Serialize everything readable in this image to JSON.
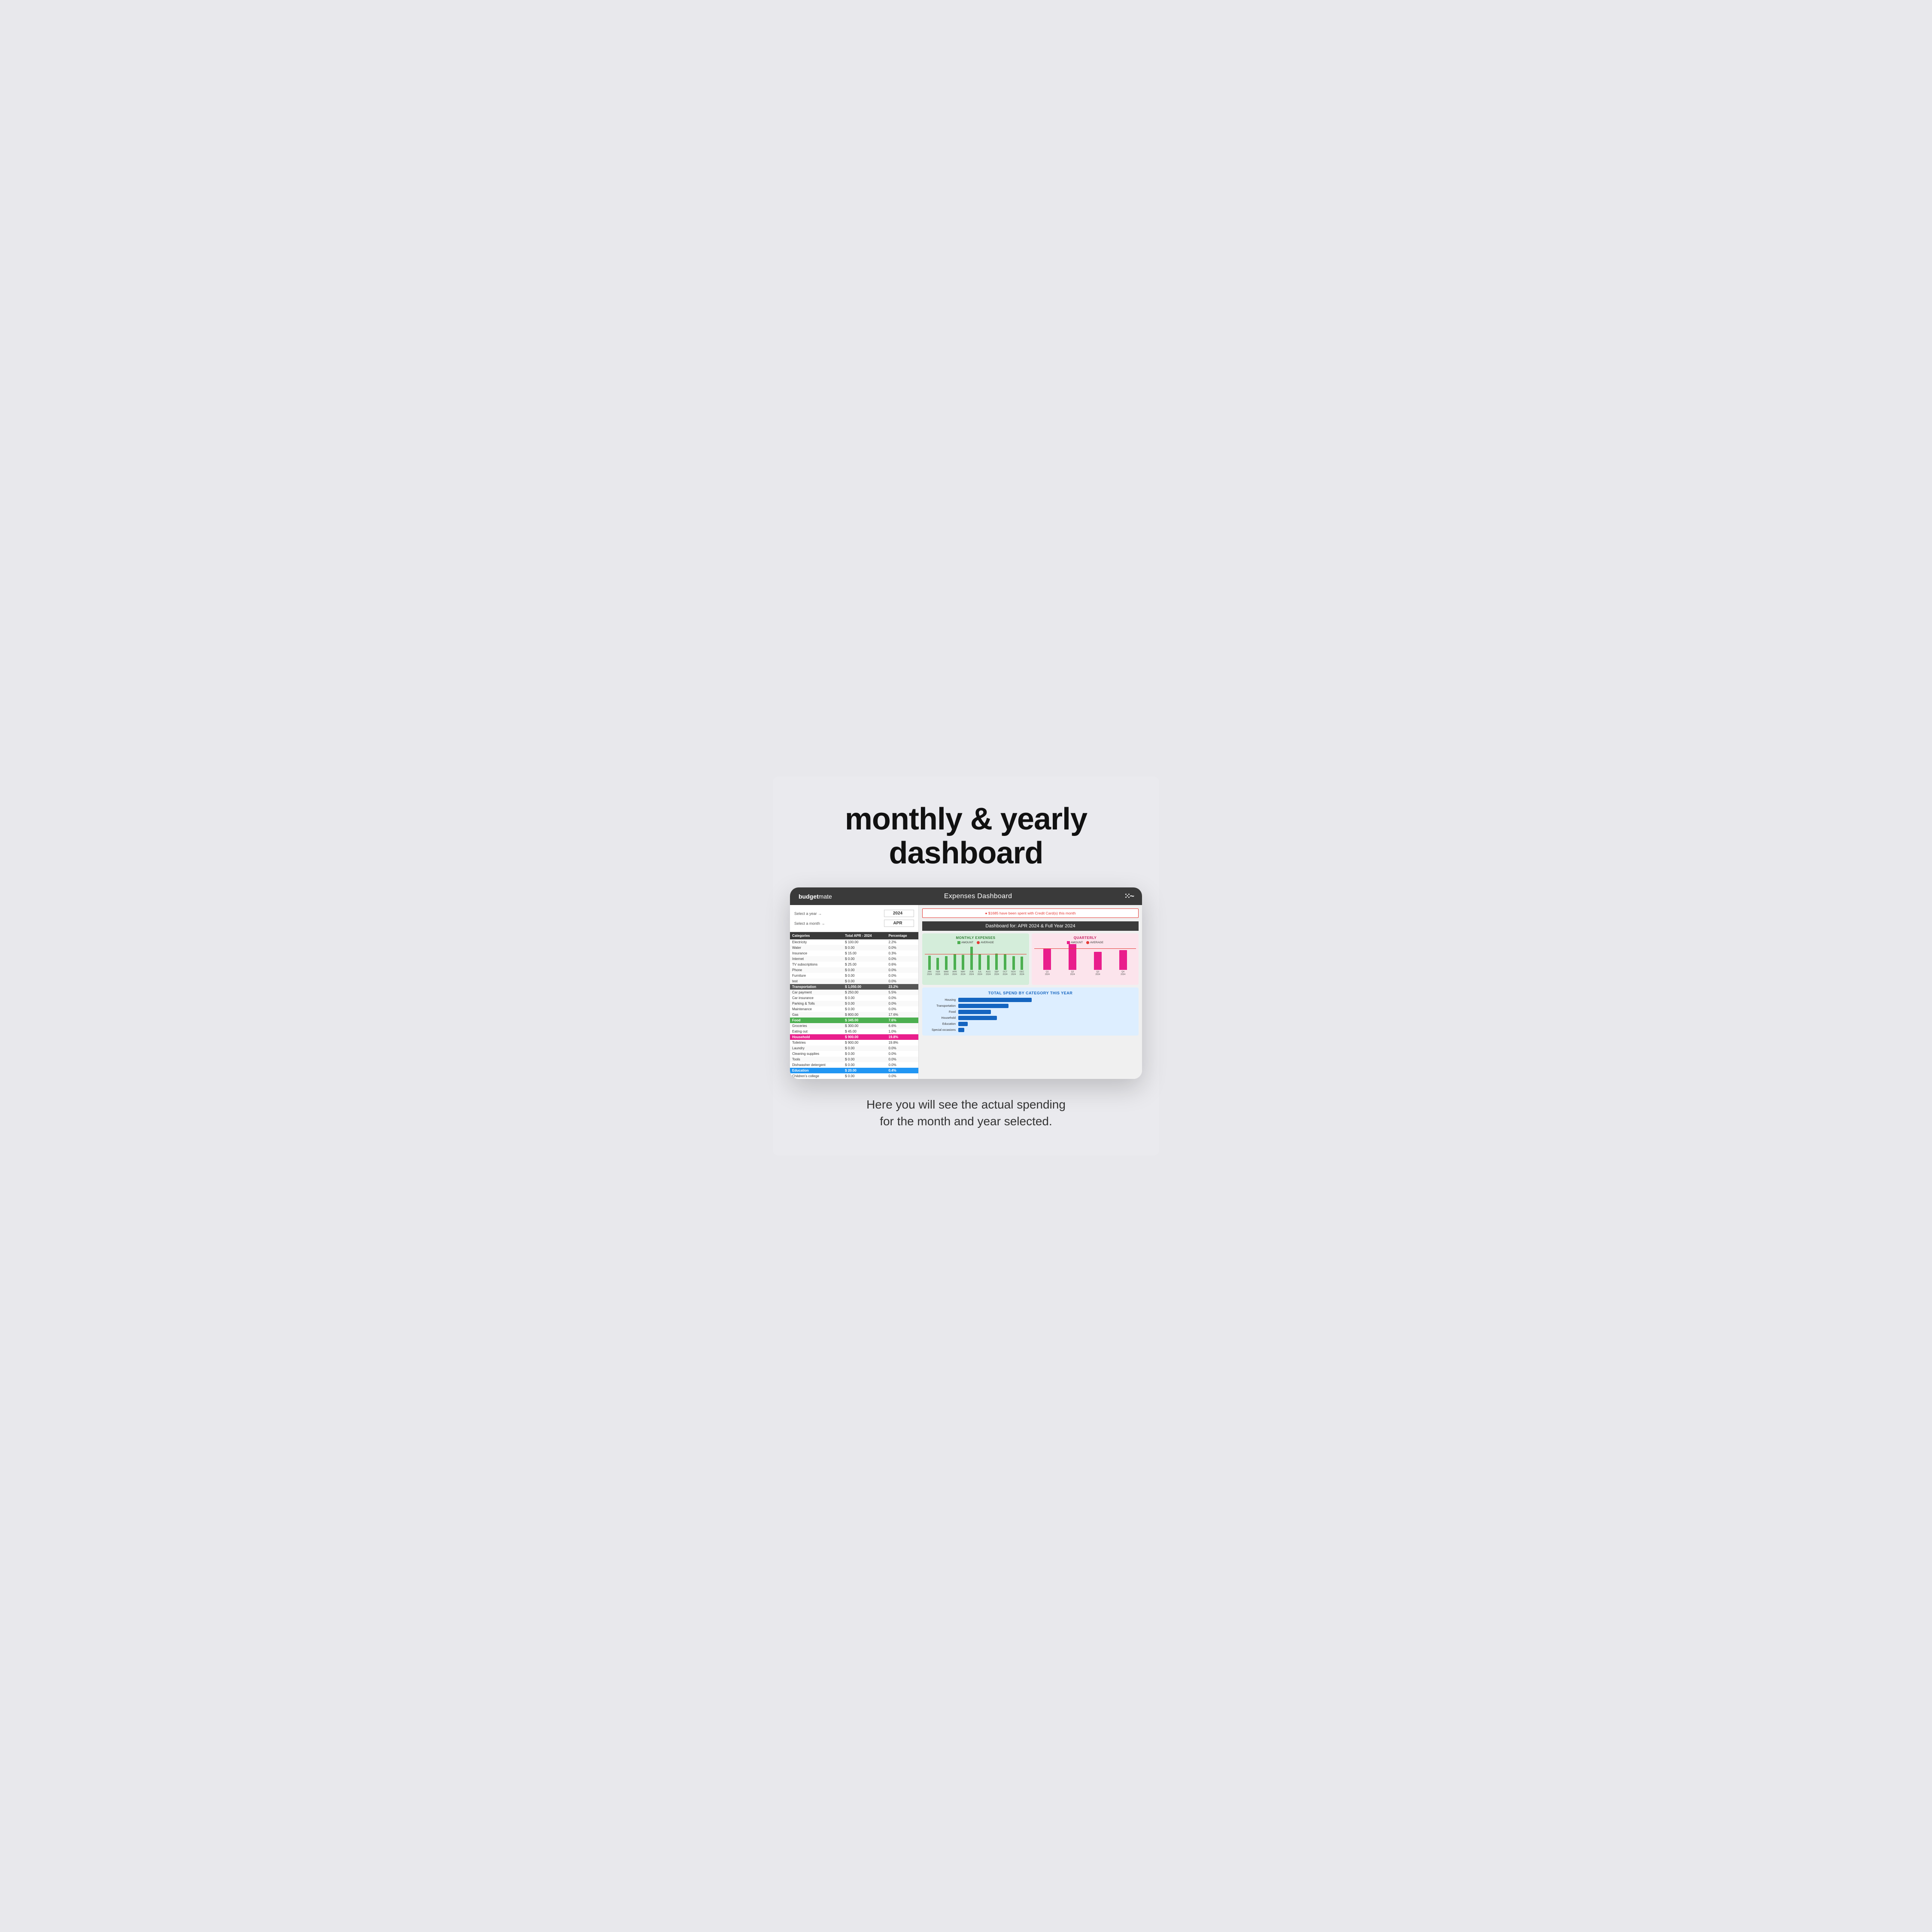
{
  "headline": {
    "line1": "monthly & yearly",
    "line2": "dashboard"
  },
  "header": {
    "brand_prefix": "budget",
    "brand_suffix": "mate",
    "title": "Expenses Dashboard",
    "logo": "w~"
  },
  "selectors": {
    "year_label": "Select a year →",
    "year_value": "2024",
    "month_label": "Select a month →",
    "month_value": "APR"
  },
  "table": {
    "headers": [
      "Categories",
      "Total APR - 2024",
      "Percentage"
    ],
    "rows": [
      {
        "name": "Electricity",
        "amount": "$ 100.00",
        "pct": "2.2%",
        "group": false
      },
      {
        "name": "Water",
        "amount": "$ 0.00",
        "pct": "0.0%",
        "group": false
      },
      {
        "name": "Insurance",
        "amount": "$ 15.00",
        "pct": "0.3%",
        "group": false
      },
      {
        "name": "Internet",
        "amount": "$ 0.00",
        "pct": "0.0%",
        "group": false
      },
      {
        "name": "TV subscriptions",
        "amount": "$ 25.00",
        "pct": "0.6%",
        "group": false
      },
      {
        "name": "Phone",
        "amount": "$ 0.00",
        "pct": "0.0%",
        "group": false
      },
      {
        "name": "Furniture",
        "amount": "$ 0.00",
        "pct": "0.0%",
        "group": false
      },
      {
        "name": "test",
        "amount": "$ 0.00",
        "pct": "0.0%",
        "group": false
      },
      {
        "name": "Transportation",
        "amount": "$ 1,050.00",
        "pct": "23.2%",
        "group": true,
        "color": "gray"
      },
      {
        "name": "Car payment",
        "amount": "$ 250.00",
        "pct": "5.5%",
        "group": false
      },
      {
        "name": "Car insurance",
        "amount": "$ 0.00",
        "pct": "0.0%",
        "group": false
      },
      {
        "name": "Parking & Tolls",
        "amount": "$ 0.00",
        "pct": "0.0%",
        "group": false
      },
      {
        "name": "Maintenance",
        "amount": "$ 0.00",
        "pct": "0.0%",
        "group": false
      },
      {
        "name": "Gas",
        "amount": "$ 800.00",
        "pct": "17.6%",
        "group": false
      },
      {
        "name": "Food",
        "amount": "$ 345.00",
        "pct": "7.6%",
        "group": true,
        "color": "green"
      },
      {
        "name": "Groceries",
        "amount": "$ 300.00",
        "pct": "6.6%",
        "group": false
      },
      {
        "name": "Eating out",
        "amount": "$ 45.00",
        "pct": "1.0%",
        "group": false
      },
      {
        "name": "Household",
        "amount": "$ 900.00",
        "pct": "19.8%",
        "group": true,
        "color": "pink"
      },
      {
        "name": "Toiletries",
        "amount": "$ 900.00",
        "pct": "19.8%",
        "group": false
      },
      {
        "name": "Laundry",
        "amount": "$ 0.00",
        "pct": "0.0%",
        "group": false
      },
      {
        "name": "Cleaning supplies",
        "amount": "$ 0.00",
        "pct": "0.0%",
        "group": false
      },
      {
        "name": "Tools",
        "amount": "$ 0.00",
        "pct": "0.0%",
        "group": false
      },
      {
        "name": "Dishwasher detergent",
        "amount": "$ 0.00",
        "pct": "0.0%",
        "group": false
      },
      {
        "name": "Education",
        "amount": "$ 20.00",
        "pct": "0.4%",
        "group": true,
        "color": "blue"
      },
      {
        "name": "Children's college",
        "amount": "$ 0.00",
        "pct": "0.0%",
        "group": false
      }
    ]
  },
  "credit_alert": "$1685 have been spent with Credit Card(s) this month",
  "dashboard_subtitle": "Dashboard for: APR 2024 & Full Year 2024",
  "monthly_chart": {
    "title": "MONTHLY EXPENSES",
    "legend_amount": "AMOUNT",
    "legend_average": "AVERAGE",
    "y_max": 8000,
    "bars": [
      {
        "label": "JAN\n2024",
        "value": 3800
      },
      {
        "label": "FEB\n2024",
        "value": 3200
      },
      {
        "label": "MAR\n2024",
        "value": 3600
      },
      {
        "label": "APR\n2024",
        "value": 4200
      },
      {
        "label": "MAY\n2024",
        "value": 4000
      },
      {
        "label": "JUN\n2024",
        "value": 6200
      },
      {
        "label": "JUL\n2024",
        "value": 4100
      },
      {
        "label": "AUG\n2024",
        "value": 3900
      },
      {
        "label": "SEP\n2024",
        "value": 4300
      },
      {
        "label": "OCT\n2024",
        "value": 4100
      },
      {
        "label": "NOV\n2024",
        "value": 3700
      },
      {
        "label": "DEC\n2024",
        "value": 3500
      }
    ],
    "average": 4100
  },
  "quarterly_chart": {
    "title": "QUARTERLY",
    "legend_amount": "AMOUNT",
    "legend_average": "AVERAGE",
    "y_max": 20000,
    "bars": [
      {
        "label": "Q1\n2024",
        "value": 14000
      },
      {
        "label": "Q2\n2024",
        "value": 17000
      },
      {
        "label": "Q3\n2024",
        "value": 12000
      },
      {
        "label": "Q4\n2024",
        "value": 13000
      }
    ],
    "average": 14000
  },
  "category_chart": {
    "title": "TOTAL SPEND BY CATEGORY THIS YEAR",
    "bars": [
      {
        "label": "Housing",
        "value": 95
      },
      {
        "label": "Transportation",
        "value": 65
      },
      {
        "label": "Food",
        "value": 42
      },
      {
        "label": "Household",
        "value": 50
      },
      {
        "label": "Education",
        "value": 12
      },
      {
        "label": "Special occasions",
        "value": 8
      }
    ],
    "max_value": 100
  },
  "footer": {
    "line1": "Here you will see the actual spending",
    "line2": "for the month and year selected."
  },
  "colors": {
    "header_bg": "#3a3a3a",
    "green_bar": "#4caf50",
    "pink_bar": "#e91e8c",
    "blue_bar": "#1565c0",
    "avg_line": "#e53935",
    "monthly_bg": "#d4edda",
    "quarterly_bg": "#fce4ec",
    "category_bg": "#ddeeff"
  }
}
